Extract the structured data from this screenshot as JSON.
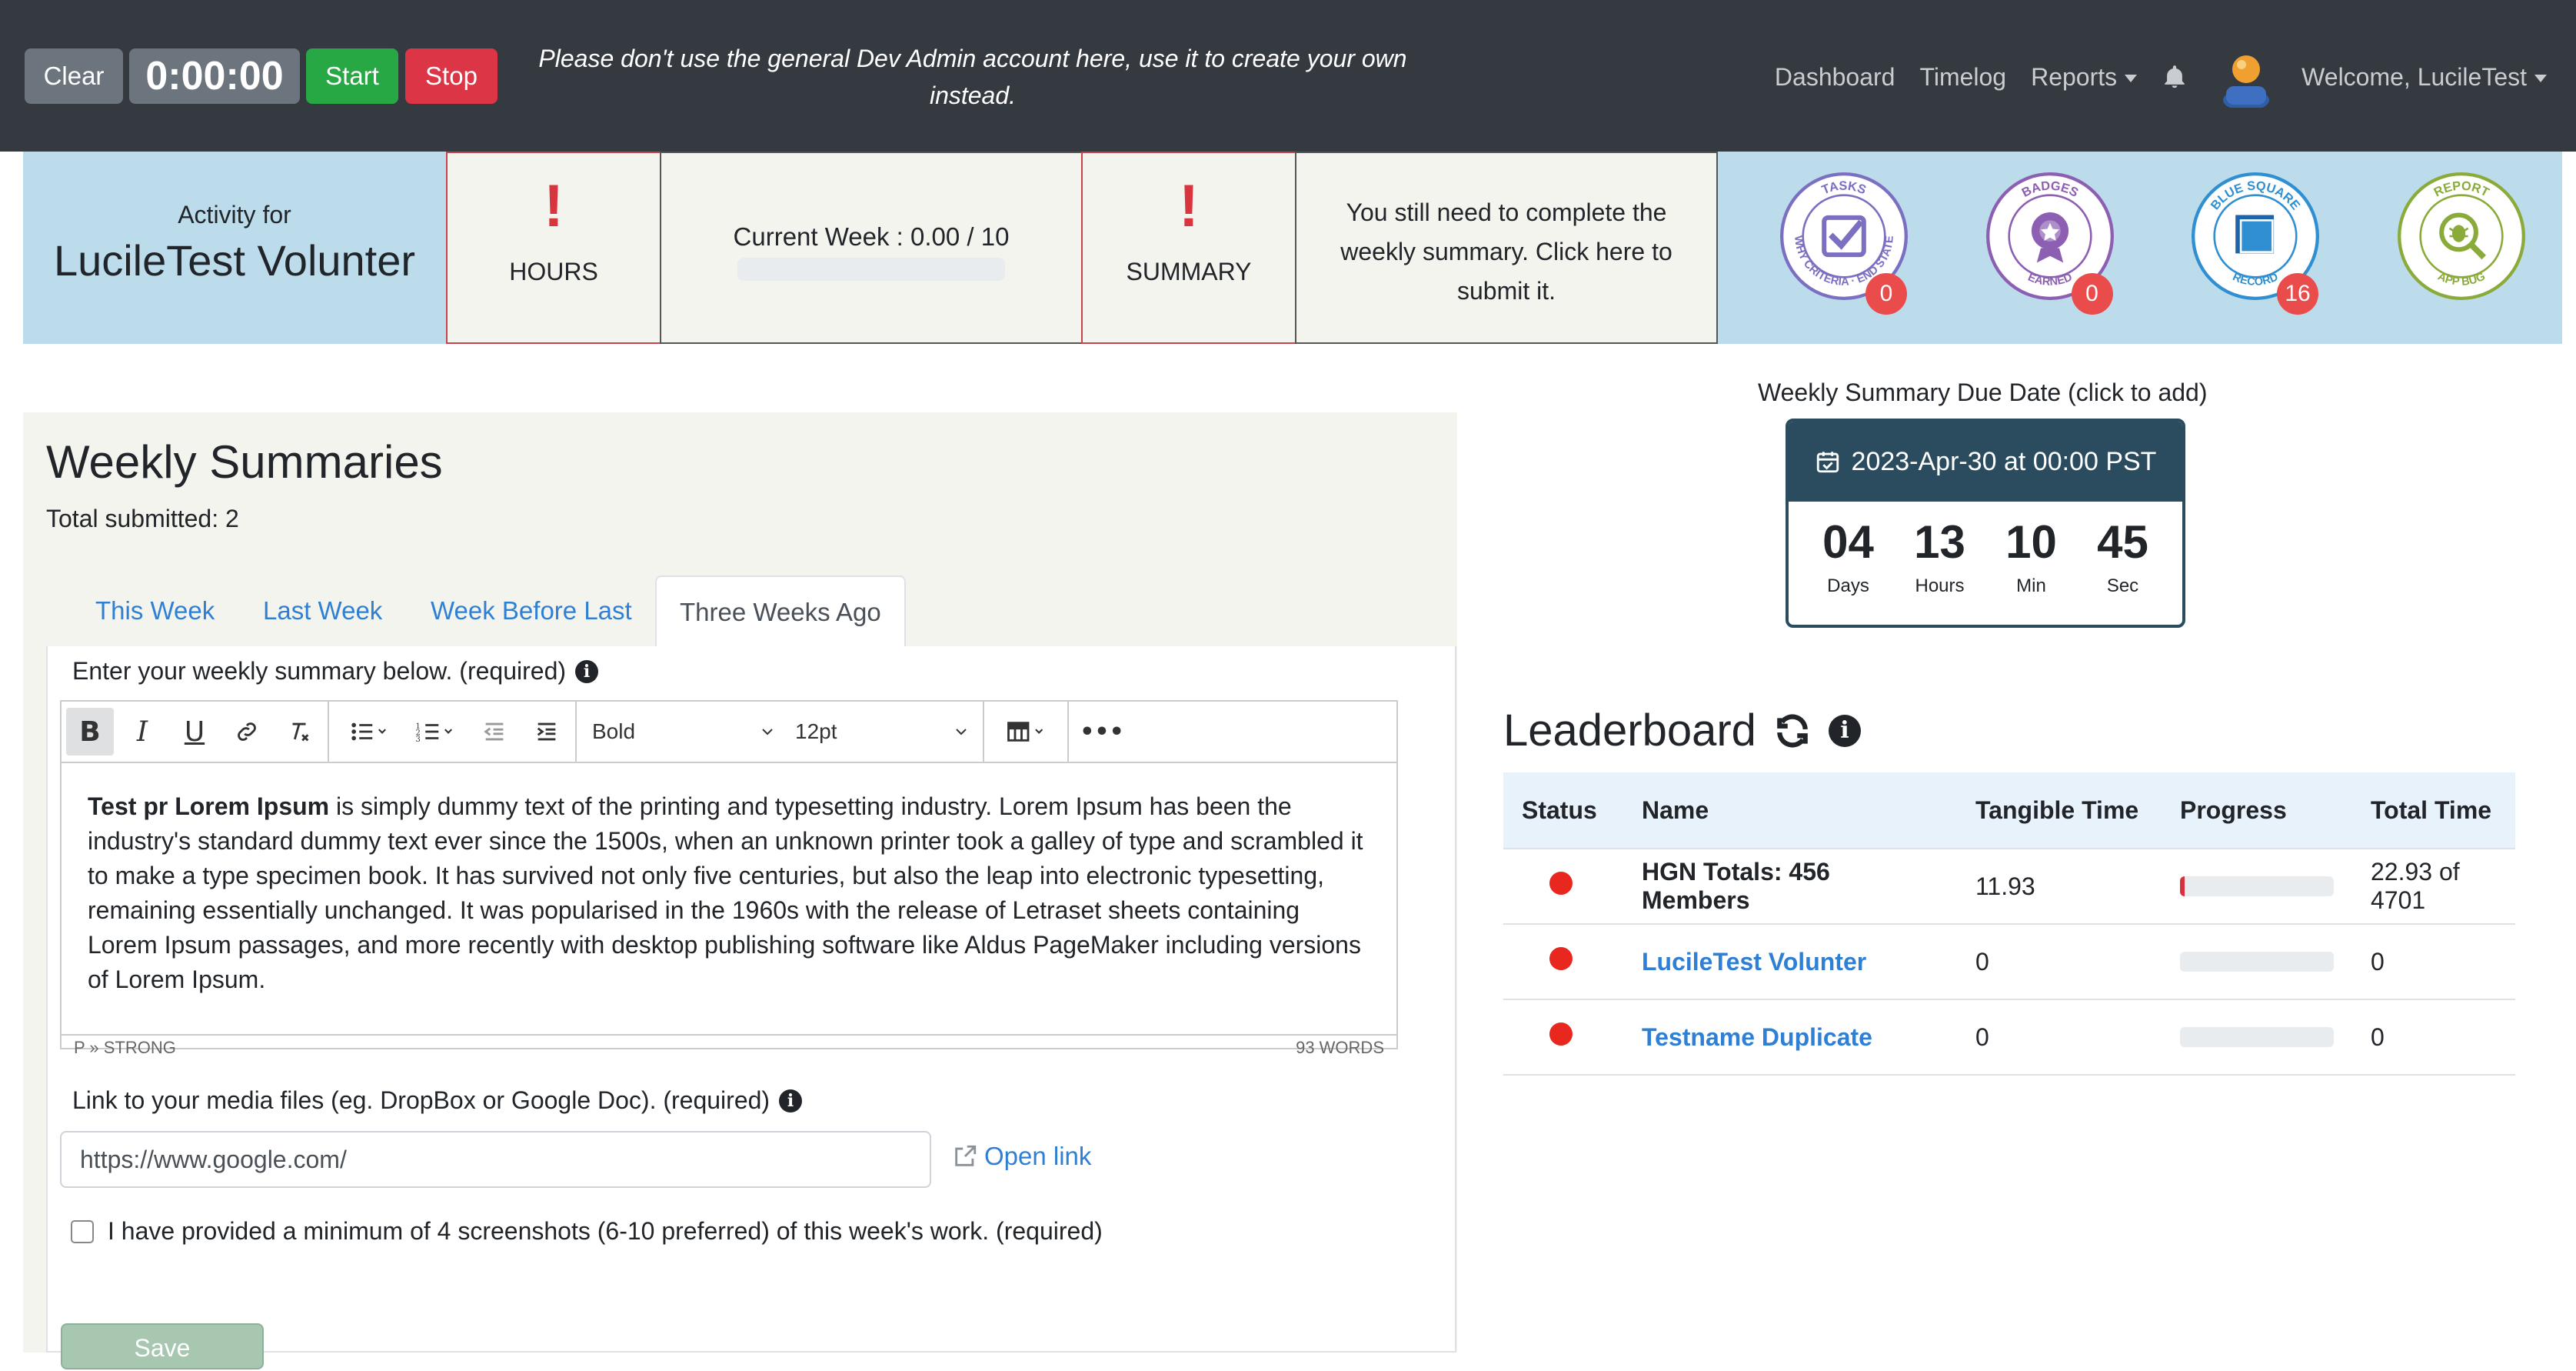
{
  "navbar": {
    "clear_label": "Clear",
    "timer": "0:00:00",
    "start_label": "Start",
    "stop_label": "Stop",
    "warning": "Please don't use the general Dev Admin account here, use it to create your own instead.",
    "links": {
      "dashboard": "Dashboard",
      "timelog": "Timelog",
      "reports": "Reports",
      "welcome": "Welcome, LucileTest"
    },
    "icons": [
      "bell-icon",
      "avatar"
    ]
  },
  "summary_bar": {
    "activity_label": "Activity for",
    "user_name": "LucileTest Volunter",
    "hours_alert": "!",
    "hours_caption": "HOURS",
    "current_week": "Current Week : 0.00 / 10",
    "current_week_progress": 0,
    "summary_alert": "!",
    "summary_caption": "SUMMARY",
    "reminder": "You still need to complete the weekly summary. Click here to submit it.",
    "badges": [
      {
        "name": "tasks-badge",
        "top": "TASKS",
        "bottom": "WHY CRITERIA · END STATE",
        "count": "0",
        "color": "#7b6fc2"
      },
      {
        "name": "badges-earned-badge",
        "top": "BADGES",
        "bottom": "EARNED",
        "count": "0",
        "color": "#8c5fb3"
      },
      {
        "name": "blue-square-badge",
        "top": "BLUE SQUARE",
        "bottom": "RECORD",
        "count": "16",
        "color": "#2f8fd1"
      },
      {
        "name": "report-bug-badge",
        "top": "REPORT",
        "bottom": "APP BUG",
        "count": "",
        "color": "#8aab3a"
      }
    ]
  },
  "weekly": {
    "title": "Weekly Summaries",
    "total": "Total submitted: 2",
    "tabs": [
      "This Week",
      "Last Week",
      "Week Before Last",
      "Three Weeks Ago"
    ],
    "active_tab": "Three Weeks Ago",
    "prompt": "Enter your weekly summary below. (required)",
    "toolbar": {
      "bold": "B",
      "italic": "I",
      "underline": "U",
      "format": "Bold",
      "size": "12pt"
    },
    "body_bold": "Test pr Lorem Ipsum",
    "body_rest": " is simply dummy text of the printing and typesetting industry. Lorem Ipsum has been the industry's standard dummy text ever since the 1500s, when an unknown printer took a galley of type and scrambled it to make a type specimen book. It has survived not only five centuries, but also the leap into electronic typesetting, remaining essentially unchanged. It was popularised in the 1960s with the release of Letraset sheets containing Lorem Ipsum passages, and more recently with desktop publishing software like Aldus PageMaker including versions of Lorem Ipsum.",
    "path": "P » STRONG",
    "word_count": "93 WORDS",
    "media_label": "Link to your media files (eg. DropBox or Google Doc). (required)",
    "media_url": "https://www.google.com/",
    "open_link": "Open link",
    "screenshot_check": "I have provided a minimum of 4 screenshots (6-10 preferred) of this week's work. (required)",
    "save_label": "Save"
  },
  "due": {
    "label": "Weekly Summary Due Date (click to add)",
    "date": "2023-Apr-30 at 00:00 PST",
    "countdown": [
      {
        "n": "04",
        "u": "Days"
      },
      {
        "n": "13",
        "u": "Hours"
      },
      {
        "n": "10",
        "u": "Min"
      },
      {
        "n": "45",
        "u": "Sec"
      }
    ]
  },
  "leaderboard": {
    "title": "Leaderboard",
    "columns": [
      "Status",
      "Name",
      "Tangible Time",
      "Progress",
      "Total Time"
    ],
    "rows": [
      {
        "name": "HGN Totals: 456 Members",
        "tangible": "11.93",
        "progress": 0.03,
        "total": "22.93 of 4701",
        "link": false
      },
      {
        "name": "LucileTest Volunter",
        "tangible": "0",
        "progress": 0,
        "total": "0",
        "link": true
      },
      {
        "name": "Testname Duplicate",
        "tangible": "0",
        "progress": 0,
        "total": "0",
        "link": true
      }
    ]
  }
}
